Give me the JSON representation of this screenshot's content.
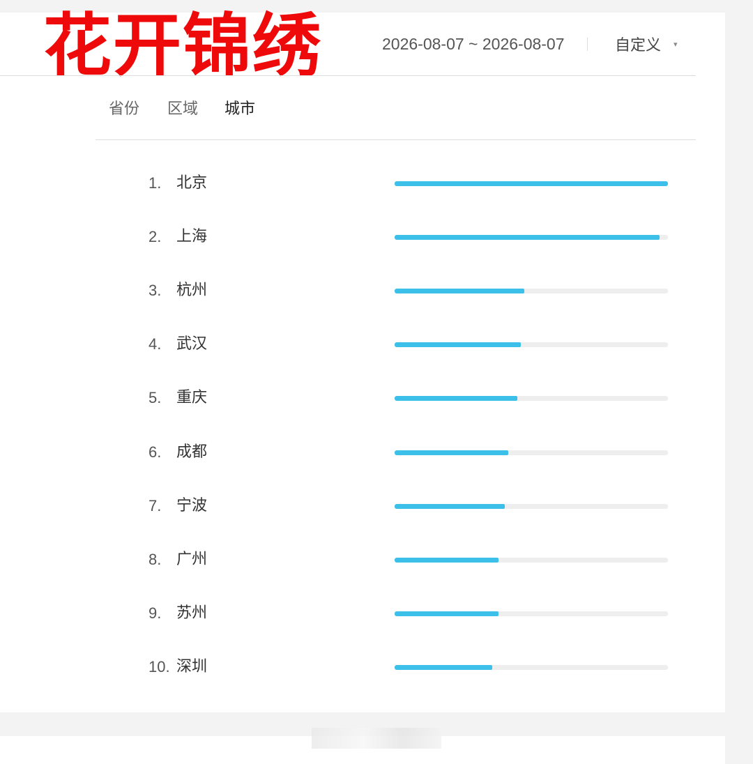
{
  "overlay_title": "花开锦绣",
  "date_range": "2026-08-07 ~ 2026-08-07",
  "range_select": {
    "label": "自定义",
    "caret": "▾"
  },
  "tabs": [
    {
      "label": "省份",
      "active": false
    },
    {
      "label": "区域",
      "active": false
    },
    {
      "label": "城市",
      "active": true
    }
  ],
  "colors": {
    "bar": "#3cc0ea",
    "track": "#eeeeee",
    "title": "#ee0a0a"
  },
  "ranking": [
    {
      "rank": "1.",
      "city": "北京",
      "level": 1.0
    },
    {
      "rank": "2.",
      "city": "上海",
      "level": 0.97
    },
    {
      "rank": "3.",
      "city": "杭州",
      "level": 0.475
    },
    {
      "rank": "4.",
      "city": "武汉",
      "level": 0.463
    },
    {
      "rank": "5.",
      "city": "重庆",
      "level": 0.449
    },
    {
      "rank": "6.",
      "city": "成都",
      "level": 0.416
    },
    {
      "rank": "7.",
      "city": "宁波",
      "level": 0.403
    },
    {
      "rank": "8.",
      "city": "广州",
      "level": 0.381
    },
    {
      "rank": "9.",
      "city": "苏州",
      "level": 0.381
    },
    {
      "rank": "10.",
      "city": "深圳",
      "level": 0.357
    }
  ]
}
